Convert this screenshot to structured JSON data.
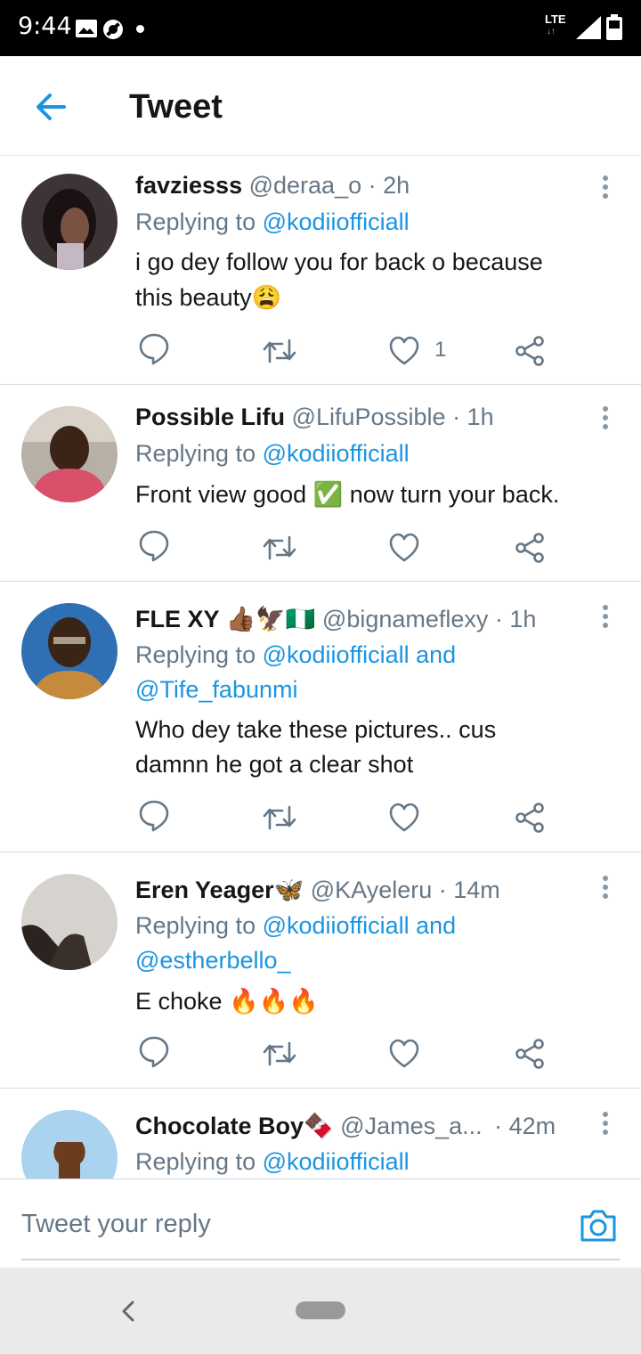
{
  "status_bar": {
    "time": "9:44",
    "network": "LTE"
  },
  "header": {
    "title": "Tweet"
  },
  "tweets": [
    {
      "name": "favziesss",
      "handle": "@deraa_o",
      "time": "· 2h",
      "replying_prefix": "Replying to",
      "replying_to": "@kodiiofficiall",
      "text_lines": [
        "i go dey follow you for back o because",
        "this beauty😩"
      ],
      "like_count": "1"
    },
    {
      "name": "Possible Lifu",
      "handle": "@LifuPossible",
      "time": "· 1h",
      "replying_prefix": "Replying to",
      "replying_to": "@kodiiofficiall",
      "text_lines": [
        "Front view good ✅ now turn your back."
      ],
      "like_count": ""
    },
    {
      "name": "FLE XY 👍🏾🦅🇳🇬",
      "handle": "@bignameflexy",
      "time": "· 1h",
      "replying_prefix": "Replying to",
      "replying_to": "@kodiiofficiall and",
      "replying_to_2": "@Tife_fabunmi",
      "text_lines": [
        "Who dey take these pictures.. cus",
        "damnn he got a clear shot"
      ],
      "like_count": ""
    },
    {
      "name": "Eren Yeager🦋",
      "handle": "@KAyeleru",
      "time": "· 14m",
      "replying_prefix": "Replying to",
      "replying_to": "@kodiiofficiall and",
      "replying_to_2": "@estherbello_",
      "text_lines": [
        "E choke 🔥🔥🔥"
      ],
      "like_count": ""
    },
    {
      "name": "Chocolate Boy🍫",
      "handle": "@James_a...",
      "time": "· 42m",
      "replying_prefix": "Replying to",
      "replying_to": "@kodiiofficiall"
    }
  ],
  "reply_bar": {
    "placeholder": "Tweet your reply"
  },
  "icons": {
    "back": "arrow-left-icon",
    "more": "more-vertical-icon",
    "reply": "comment-icon",
    "retweet": "retweet-icon",
    "like": "heart-icon",
    "share": "share-icon",
    "camera": "camera-icon"
  },
  "colors": {
    "accent": "#1b95e0",
    "secondary_text": "#657786",
    "primary_text": "#14171a",
    "divider": "#d5dce1"
  }
}
